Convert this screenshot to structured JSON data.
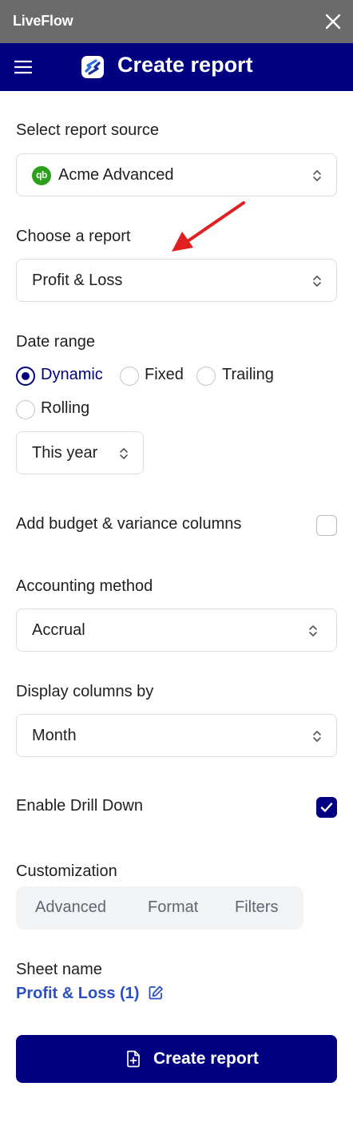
{
  "window": {
    "app_name": "LiveFlow",
    "close_icon": "close-icon"
  },
  "header": {
    "title": "Create report",
    "menu_icon": "hamburger-menu-icon",
    "logo_icon": "liveflow-logo-icon",
    "background": "#000080"
  },
  "report_source": {
    "label": "Select report source",
    "value": "Acme Advanced",
    "source_icon": "quickbooks-icon",
    "source_icon_text": "qb"
  },
  "report": {
    "label": "Choose a report",
    "value": "Profit & Loss"
  },
  "date_range": {
    "label": "Date range",
    "options": [
      "Dynamic",
      "Fixed",
      "Trailing",
      "Rolling"
    ],
    "selected": "Dynamic",
    "period_value": "This year"
  },
  "budget": {
    "label": "Add budget & variance columns",
    "checked": false
  },
  "accounting": {
    "label": "Accounting method",
    "value": "Accrual"
  },
  "display_columns": {
    "label": "Display columns by",
    "value": "Month"
  },
  "drill_down": {
    "label": "Enable Drill Down",
    "checked": true
  },
  "customization": {
    "label": "Customization",
    "tabs": [
      "Advanced",
      "Format",
      "Filters"
    ]
  },
  "sheet": {
    "label": "Sheet name",
    "name": "Profit & Loss (1)",
    "edit_icon": "edit-icon"
  },
  "create_button": {
    "label": "Create report",
    "icon": "file-plus-icon"
  },
  "annotation": {
    "arrow_color": "#e02020"
  },
  "colors": {
    "accent": "#000080",
    "link": "#2b4fc4",
    "quickbooks_green": "#2ca01c"
  }
}
